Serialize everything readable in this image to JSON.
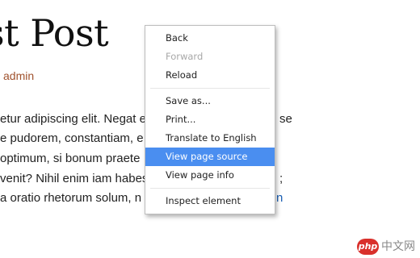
{
  "post": {
    "title": "st Post",
    "author": "admin",
    "excerpt": [
      {
        "text": "etur adipiscing elit. Negat e",
        "link": "",
        "rest": ""
      },
      {
        "text": "e pudorem, constantiam, e",
        "link": "",
        "rest": ""
      },
      {
        "text": "optimum, si bonum praete",
        "link": "",
        "rest": ""
      },
      {
        "text": "venit? Nihil enim iam habes",
        "link": "",
        "rest": ""
      },
      {
        "text": "a oratio rhetorum solum, n",
        "link": "",
        "rest": ""
      }
    ],
    "excerpt_right": [
      "se",
      "",
      "",
      ";",
      "n"
    ]
  },
  "context_menu": {
    "groups": [
      [
        {
          "label": "Back",
          "enabled": true,
          "highlighted": false
        },
        {
          "label": "Forward",
          "enabled": false,
          "highlighted": false
        },
        {
          "label": "Reload",
          "enabled": true,
          "highlighted": false
        }
      ],
      [
        {
          "label": "Save as...",
          "enabled": true,
          "highlighted": false
        },
        {
          "label": "Print...",
          "enabled": true,
          "highlighted": false
        },
        {
          "label": "Translate to English",
          "enabled": true,
          "highlighted": false
        },
        {
          "label": "View page source",
          "enabled": true,
          "highlighted": true
        },
        {
          "label": "View page info",
          "enabled": true,
          "highlighted": false
        }
      ],
      [
        {
          "label": "Inspect element",
          "enabled": true,
          "highlighted": false
        }
      ]
    ]
  },
  "watermark": {
    "badge": "php",
    "text": "中文网"
  },
  "colors": {
    "highlight": "#4a8ef0",
    "author_link": "#a0522d",
    "inline_link": "#1a5fb4",
    "disabled_text": "#a8a8a8",
    "watermark_badge": "#d9302b"
  }
}
